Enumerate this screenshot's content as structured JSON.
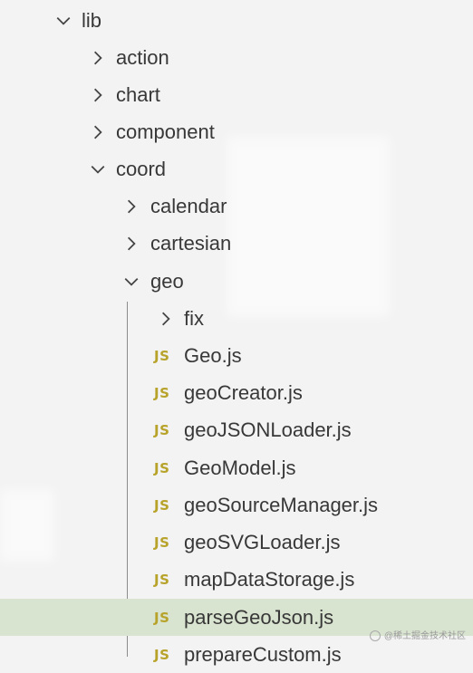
{
  "tree": [
    {
      "label": "lib",
      "type": "folder",
      "expanded": true,
      "icon": "chevron-down-icon"
    },
    {
      "label": "action",
      "type": "folder",
      "expanded": false,
      "icon": "chevron-right-icon"
    },
    {
      "label": "chart",
      "type": "folder",
      "expanded": false,
      "icon": "chevron-right-icon"
    },
    {
      "label": "component",
      "type": "folder",
      "expanded": false,
      "icon": "chevron-right-icon"
    },
    {
      "label": "coord",
      "type": "folder",
      "expanded": true,
      "icon": "chevron-down-icon"
    },
    {
      "label": "calendar",
      "type": "folder",
      "expanded": false,
      "icon": "chevron-right-icon"
    },
    {
      "label": "cartesian",
      "type": "folder",
      "expanded": false,
      "icon": "chevron-right-icon"
    },
    {
      "label": "geo",
      "type": "folder",
      "expanded": true,
      "icon": "chevron-down-icon"
    },
    {
      "label": "fix",
      "type": "folder",
      "expanded": false,
      "icon": "chevron-right-icon"
    },
    {
      "label": "Geo.js",
      "type": "file",
      "badge": "JS"
    },
    {
      "label": "geoCreator.js",
      "type": "file",
      "badge": "JS"
    },
    {
      "label": "geoJSONLoader.js",
      "type": "file",
      "badge": "JS"
    },
    {
      "label": "GeoModel.js",
      "type": "file",
      "badge": "JS"
    },
    {
      "label": "geoSourceManager.js",
      "type": "file",
      "badge": "JS"
    },
    {
      "label": "geoSVGLoader.js",
      "type": "file",
      "badge": "JS"
    },
    {
      "label": "mapDataStorage.js",
      "type": "file",
      "badge": "JS"
    },
    {
      "label": "parseGeoJson.js",
      "type": "file",
      "badge": "JS",
      "selected": true
    },
    {
      "label": "prepareCustom.js",
      "type": "file",
      "badge": "JS"
    }
  ],
  "watermark": "@稀土掘金技术社区",
  "colors": {
    "background": "#f3f3f3",
    "selected_row": "#d8e3d0",
    "js_badge": "#b8a32a",
    "text": "#383838"
  }
}
